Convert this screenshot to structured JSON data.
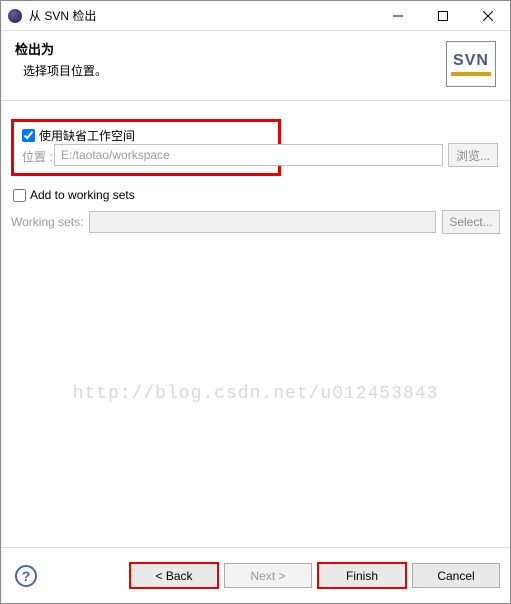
{
  "titlebar": {
    "title": "从 SVN 检出"
  },
  "header": {
    "title": "检出为",
    "subtitle": "选择项目位置。",
    "logo_text": "SVN"
  },
  "workspace": {
    "use_default_label": "使用缺省工作空间",
    "use_default_checked": true,
    "location_label": "位置 :",
    "location_value": "E:/taotao/workspace",
    "browse_label": "浏览..."
  },
  "working_sets": {
    "add_label": "Add to working sets",
    "add_checked": false,
    "row_label": "Working sets:",
    "select_label": "Select..."
  },
  "watermark": "http://blog.csdn.net/u012453843",
  "footer": {
    "back": "< Back",
    "next": "Next >",
    "finish": "Finish",
    "cancel": "Cancel"
  }
}
